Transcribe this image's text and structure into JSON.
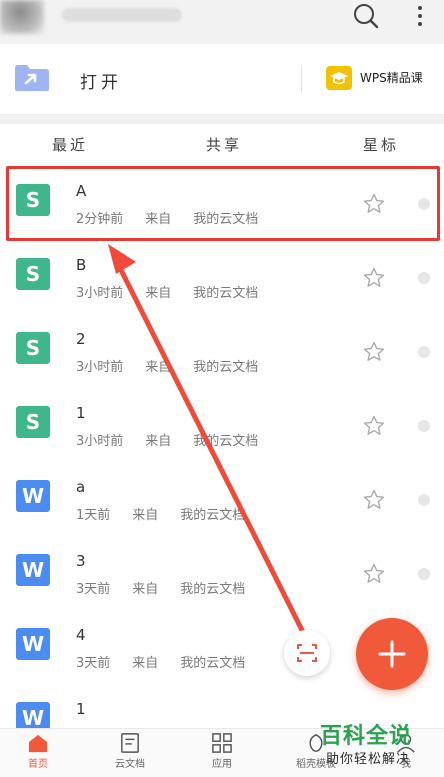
{
  "open_bar": {
    "open_label": "打开",
    "course_label": "WPS精品课"
  },
  "tabs": [
    {
      "label": "最近"
    },
    {
      "label": "共享"
    },
    {
      "label": "星标"
    }
  ],
  "files": [
    {
      "name": "A",
      "type": "S",
      "time": "2分钟前",
      "from": "来自",
      "source": "我的云文档"
    },
    {
      "name": "B",
      "type": "S",
      "time": "3小时前",
      "from": "来自",
      "source": "我的云文档"
    },
    {
      "name": "2",
      "type": "S",
      "time": "3小时前",
      "from": "来自",
      "source": "我的云文档"
    },
    {
      "name": "1",
      "type": "S",
      "time": "3小时前",
      "from": "来自",
      "source": "我的云文档"
    },
    {
      "name": "a",
      "type": "W",
      "time": "1天前",
      "from": "来自",
      "source": "我的云文档"
    },
    {
      "name": "3",
      "type": "W",
      "time": "3天前",
      "from": "来自",
      "source": "我的云文档"
    },
    {
      "name": "4",
      "type": "W",
      "time": "3天前",
      "from": "来自",
      "source": "我的云文档"
    },
    {
      "name": "1",
      "type": "W",
      "time": "",
      "from": "",
      "source": ""
    }
  ],
  "bottom_nav": [
    {
      "label": "首页",
      "icon": "home-icon",
      "active": true
    },
    {
      "label": "云文档",
      "icon": "cloud-doc-icon",
      "active": false
    },
    {
      "label": "应用",
      "icon": "apps-grid-icon",
      "active": false
    },
    {
      "label": "稻壳模板",
      "icon": "template-icon",
      "active": false
    },
    {
      "label": "我",
      "icon": "profile-icon",
      "active": false
    }
  ],
  "watermark": {
    "title": "百科全说",
    "subtitle": "助你轻松解决"
  },
  "colors": {
    "accent": "#f0593a",
    "sheet_icon": "#3fb68b",
    "writer_icon": "#4a8cf0",
    "highlight": "#e53935",
    "watermark_green": "#2ca150"
  }
}
